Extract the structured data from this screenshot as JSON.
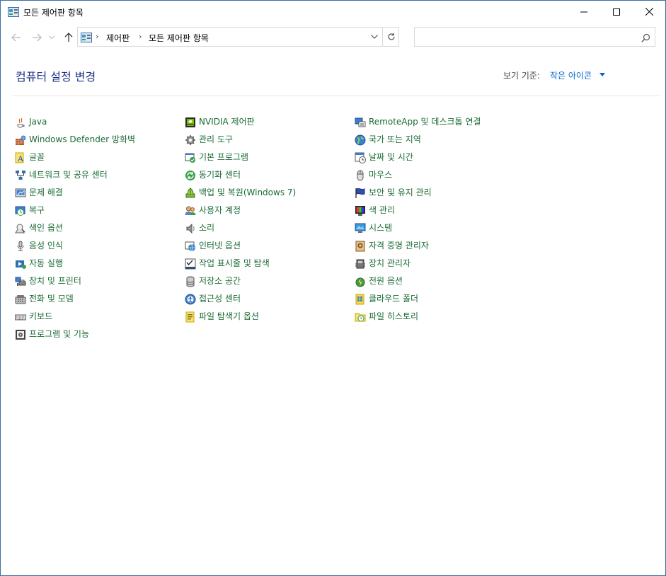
{
  "window": {
    "title": "모든 제어판 항목"
  },
  "address": {
    "crumbs": [
      "제어판",
      "모든 제어판 항목"
    ]
  },
  "search": {
    "placeholder": ""
  },
  "header": {
    "heading": "컴퓨터 설정 변경",
    "view_by_label": "보기 기준:",
    "view_by_value": "작은 아이콘"
  },
  "items": {
    "col1": [
      {
        "label": "Java",
        "icon": "java-icon"
      },
      {
        "label": "Windows Defender 방화벽",
        "icon": "firewall-icon"
      },
      {
        "label": "글꼴",
        "icon": "font-icon"
      },
      {
        "label": "네트워크 및 공유 센터",
        "icon": "network-icon"
      },
      {
        "label": "문제 해결",
        "icon": "troubleshoot-icon"
      },
      {
        "label": "복구",
        "icon": "recovery-icon"
      },
      {
        "label": "색인 옵션",
        "icon": "indexing-icon"
      },
      {
        "label": "음성 인식",
        "icon": "microphone-icon"
      },
      {
        "label": "자동 실행",
        "icon": "autoplay-icon"
      },
      {
        "label": "장치 및 프린터",
        "icon": "printer-icon"
      },
      {
        "label": "전화 및 모뎀",
        "icon": "phone-icon"
      },
      {
        "label": "키보드",
        "icon": "keyboard-icon"
      },
      {
        "label": "프로그램 및 기능",
        "icon": "programs-icon"
      }
    ],
    "col2": [
      {
        "label": "NVIDIA 제어판",
        "icon": "nvidia-icon"
      },
      {
        "label": "관리 도구",
        "icon": "admin-tools-icon"
      },
      {
        "label": "기본 프로그램",
        "icon": "default-programs-icon"
      },
      {
        "label": "동기화 센터",
        "icon": "sync-icon"
      },
      {
        "label": "백업 및 복원(Windows 7)",
        "icon": "backup-icon"
      },
      {
        "label": "사용자 계정",
        "icon": "users-icon"
      },
      {
        "label": "소리",
        "icon": "speaker-icon"
      },
      {
        "label": "인터넷 옵션",
        "icon": "internet-icon"
      },
      {
        "label": "작업 표시줄 및 탐색",
        "icon": "taskbar-icon"
      },
      {
        "label": "저장소 공간",
        "icon": "storage-icon"
      },
      {
        "label": "접근성 센터",
        "icon": "accessibility-icon"
      },
      {
        "label": "파일 탐색기 옵션",
        "icon": "folder-options-icon"
      }
    ],
    "col3": [
      {
        "label": "RemoteApp 및 데스크톱 연결",
        "icon": "remote-icon"
      },
      {
        "label": "국가 또는 지역",
        "icon": "globe-icon"
      },
      {
        "label": "날짜 및 시간",
        "icon": "clock-icon"
      },
      {
        "label": "마우스",
        "icon": "mouse-icon"
      },
      {
        "label": "보안 및 유지 관리",
        "icon": "flag-icon"
      },
      {
        "label": "색 관리",
        "icon": "color-icon"
      },
      {
        "label": "시스템",
        "icon": "monitor-icon"
      },
      {
        "label": "자격 증명 관리자",
        "icon": "credential-icon"
      },
      {
        "label": "장치 관리자",
        "icon": "device-manager-icon"
      },
      {
        "label": "전원 옵션",
        "icon": "power-icon"
      },
      {
        "label": "클라우드 폴더",
        "icon": "cloud-folder-icon"
      },
      {
        "label": "파일 히스토리",
        "icon": "file-history-icon"
      }
    ]
  },
  "colors": {
    "link": "#1a6b34",
    "heading": "#1e3287",
    "accent": "#0066cc"
  }
}
